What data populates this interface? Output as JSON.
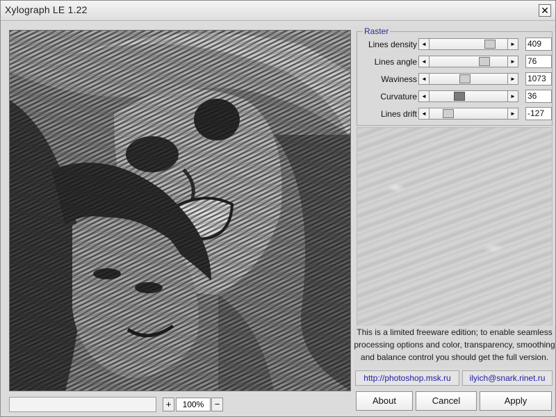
{
  "window": {
    "title": "Xylograph LE 1.22",
    "close_label": "✕"
  },
  "raster": {
    "group_title": "Raster",
    "params": [
      {
        "label": "Lines density",
        "value": "409",
        "level": 0.82
      },
      {
        "label": "Lines angle",
        "value": "76",
        "level": 0.74
      },
      {
        "label": "Waviness",
        "value": "1073",
        "level": 0.45
      },
      {
        "label": "Curvature",
        "value": "36",
        "level": 0.36
      },
      {
        "label": "Lines drift",
        "value": "-127",
        "level": 0.2
      }
    ],
    "scroll_left": "◄",
    "scroll_right": "►"
  },
  "notice": {
    "line1": "This is a limited freeware edition; to enable seamless",
    "line2": "processing options and color, transparency, smoothing",
    "line3": "and balance control you should get the full version."
  },
  "links": {
    "site": "http://photoshop.msk.ru",
    "email": "ilyich@snark.rinet.ru"
  },
  "zoom": {
    "minus": "+",
    "value": "100%",
    "plus": "−"
  },
  "buttons": {
    "about": "About",
    "cancel": "Cancel",
    "apply": "Apply"
  },
  "icons": {
    "close": "close-icon",
    "scroll_left": "arrow-left-icon",
    "scroll_right": "arrow-right-icon"
  }
}
